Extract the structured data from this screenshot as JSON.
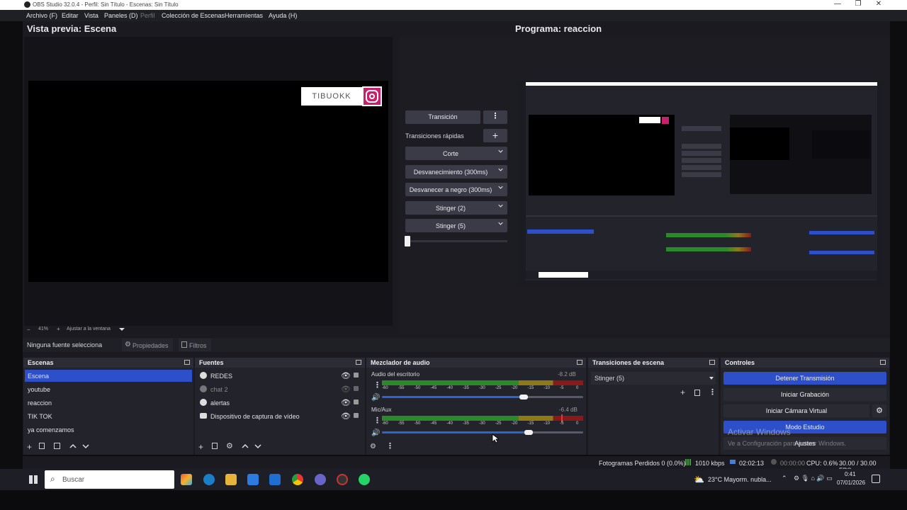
{
  "window": {
    "title": "OBS Studio 32.0.4 - Perfil: Sin Título - Escenas: Sin Título",
    "minimize": "—",
    "restore": "❐",
    "close": "✕"
  },
  "menu": [
    "Archivo (F)",
    "Editar",
    "Vista",
    "Paneles (D)",
    "Perfil",
    "Colección de Escenas",
    "Herramientas",
    "Ayuda (H)"
  ],
  "preview": {
    "title": "Vista previa: Escena",
    "zoom": "41%",
    "zoom_minus": "−",
    "zoom_plus": "+",
    "fit_label": "Ajustar a la ventana",
    "overlay_text": "TIBUOKK"
  },
  "program": {
    "title": "Programa: reaccion"
  },
  "transitions": {
    "button": "Transición",
    "quick_label": "Transiciones rápidas",
    "items": [
      "Corte",
      "Desvanecimiento (300ms)",
      "Desvanecer a negro (300ms)",
      "Stinger (2)",
      "Stinger (5)"
    ],
    "tbar_level": 0
  },
  "sourcebar": {
    "no_source": "Ninguna fuente seleccionada",
    "properties": "Propiedades",
    "filters": "Filtros"
  },
  "docks": {
    "scenes": {
      "title": "Escenas",
      "items": [
        "Escena",
        "youtube",
        "reaccion",
        "TIK TOK",
        "ya comenzamos"
      ],
      "selected": 0
    },
    "sources": {
      "title": "Fuentes",
      "items": [
        {
          "label": "REDES",
          "visible": true
        },
        {
          "label": "chat 2",
          "visible": false
        },
        {
          "label": "alertas",
          "visible": true
        },
        {
          "label": "Dispositivo de captura de vídeo",
          "visible": true
        }
      ]
    },
    "mixer": {
      "title": "Mezclador de audio",
      "channels": [
        {
          "name": "Audio del escritorio",
          "db": "-8.2 dB",
          "volume": 0.88
        },
        {
          "name": "Mic/Aux",
          "db": "-6.4 dB",
          "volume": 0.91
        }
      ],
      "ticks": [
        "-60",
        "-55",
        "-50",
        "-45",
        "-40",
        "-35",
        "-30",
        "-25",
        "-20",
        "-15",
        "-10",
        "-5",
        "0"
      ]
    },
    "scene_transitions": {
      "title": "Transiciones de escena",
      "selected": "Stinger (5)"
    },
    "controls": {
      "title": "Controles",
      "stop_stream": "Detener Transmisión",
      "start_recording": "Iniciar Grabación",
      "start_virtualcam": "Iniciar Cámara Virtual",
      "studio_mode": "Modo Estudio",
      "settings": "Ajustes",
      "activate_title": "Activar Windows",
      "activate_sub": "Ve a Configuración para activar Windows."
    }
  },
  "status": {
    "dropped": "Fotogramas Perdidos 0 (0.0%)",
    "bitrate": "1010 kbps",
    "stream_time": "02:02:13",
    "rec_time": "00:00:00",
    "cpu": "CPU: 0.6%",
    "fps": "30.00 / 30.00 FPS"
  },
  "taskbar": {
    "search_placeholder": "Buscar",
    "weather": "23°C  Mayorm. nubla...",
    "time": "0:41",
    "date": "07/01/2026"
  },
  "colors": {
    "accent": "#2d4fc9",
    "meter_green": "#2a8a2a",
    "meter_yellow": "#8d7a16",
    "meter_red": "#8a1a1a"
  }
}
